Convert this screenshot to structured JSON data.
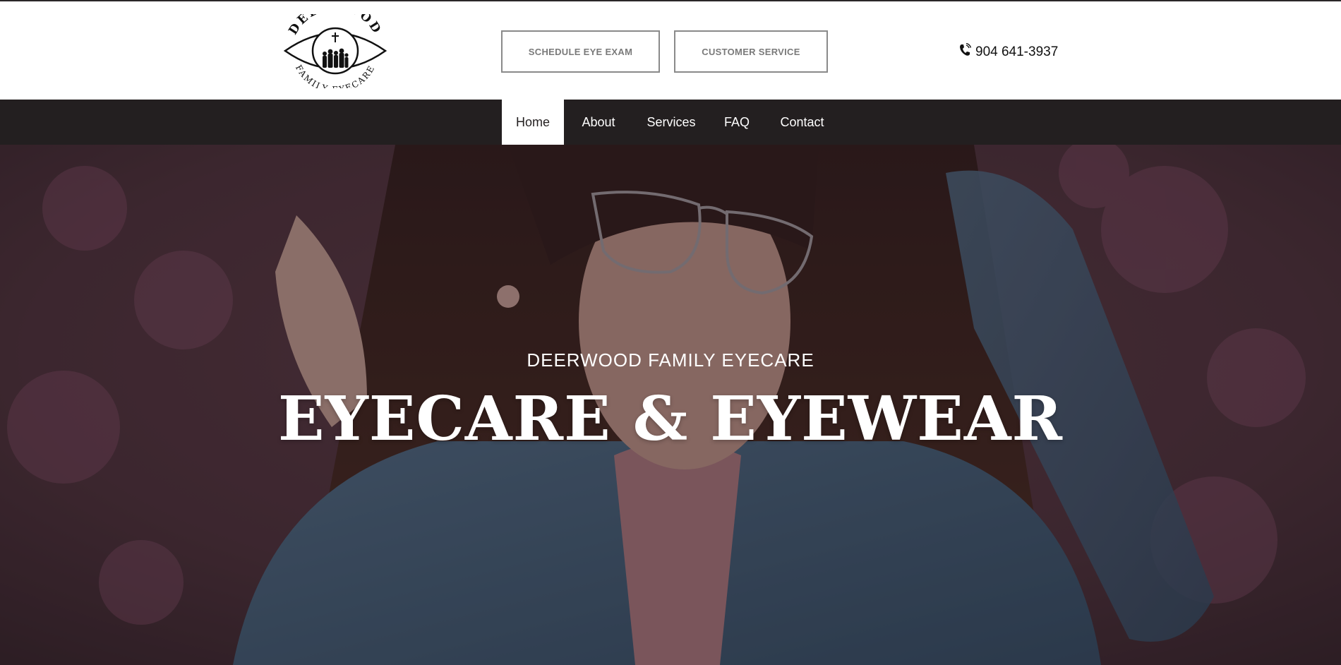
{
  "header": {
    "logo": {
      "top_text": "DEERWOOD",
      "bottom_text": "FAMILY EYECARE",
      "icon": "eye-family-logo-icon"
    },
    "schedule_button_label": "SCHEDULE EYE EXAM",
    "customer_service_button_label": "CUSTOMER SERVICE",
    "phone": {
      "icon": "phone-icon",
      "number": "904 641-3937"
    }
  },
  "nav": {
    "items": [
      {
        "label": "Home",
        "active": true
      },
      {
        "label": "About",
        "active": false
      },
      {
        "label": "Services",
        "active": false
      },
      {
        "label": "FAQ",
        "active": false
      },
      {
        "label": "Contact",
        "active": false
      }
    ]
  },
  "hero": {
    "subtitle": "DEERWOOD FAMILY EYECARE",
    "title": "EYECARE & EYEWEAR",
    "image": "woman-with-sunglasses-photo"
  },
  "colors": {
    "nav_background": "#231f20",
    "button_border": "#8a8a8a",
    "button_text": "#7a7a7a",
    "hero_text": "#ffffff"
  }
}
